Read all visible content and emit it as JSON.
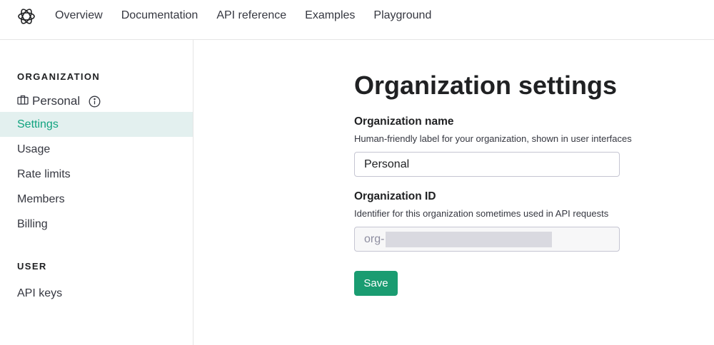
{
  "nav": {
    "links": [
      "Overview",
      "Documentation",
      "API reference",
      "Examples",
      "Playground"
    ]
  },
  "sidebar": {
    "org_heading": "ORGANIZATION",
    "org_name": "Personal",
    "items": [
      "Settings",
      "Usage",
      "Rate limits",
      "Members",
      "Billing"
    ],
    "active_item": "Settings",
    "user_heading": "USER",
    "user_items": [
      "API keys"
    ]
  },
  "main": {
    "title": "Organization settings",
    "org_name_label": "Organization name",
    "org_name_help": "Human-friendly label for your organization, shown in user interfaces",
    "org_name_value": "Personal",
    "org_id_label": "Organization ID",
    "org_id_help": "Identifier for this organization sometimes used in API requests",
    "org_id_prefix": "org-",
    "save_label": "Save"
  },
  "colors": {
    "accent": "#10a37f",
    "save_button": "#1a9c71",
    "active_bg": "#e3f0ef"
  },
  "icons": {
    "logo": "openai-logo-icon",
    "org": "briefcase-icon",
    "info": "info-icon"
  }
}
